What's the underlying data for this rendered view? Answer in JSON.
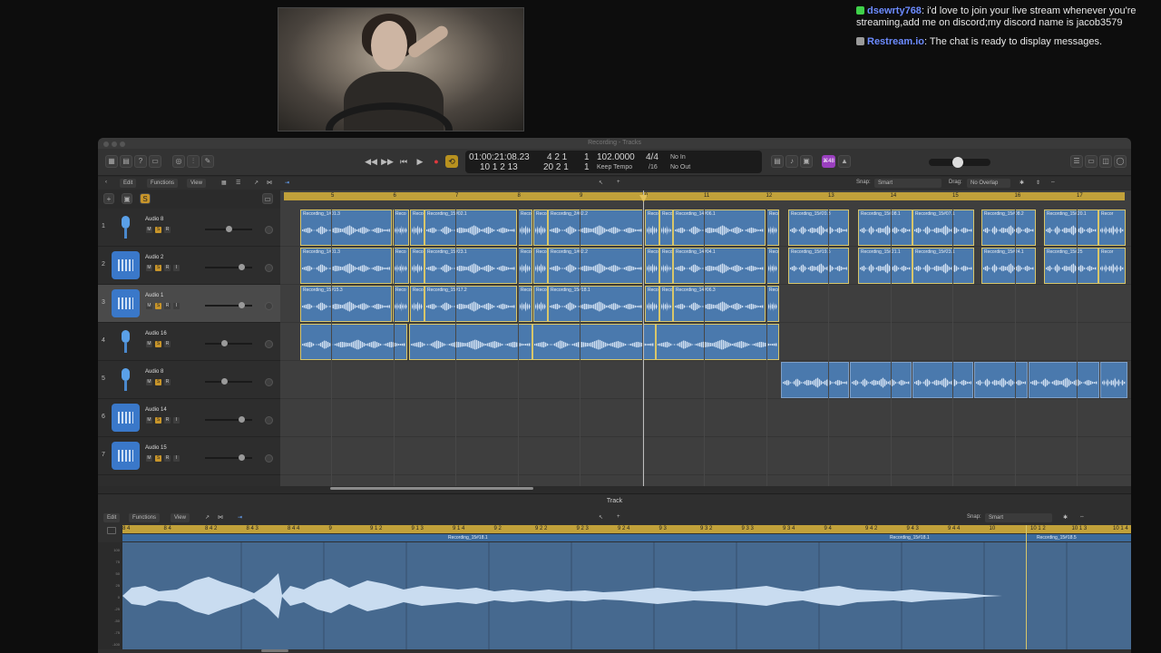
{
  "chat": {
    "messages": [
      {
        "user": "dsewrty768",
        "text": "i'd love to join your live stream whenever you're streaming,add me on discord;my discord name is jacob3579",
        "icon_color": "#3fd14a"
      },
      {
        "user": "Restream.io",
        "text": "The chat is ready to display messages.",
        "icon_color": "#9a9a9a"
      }
    ]
  },
  "window": {
    "title": "Recording - Tracks"
  },
  "lcd": {
    "time": "01:00:21:08.23",
    "time_sub": "10  1  2   13",
    "bars": "4  2  1",
    "bars_beat": "1",
    "bars_sub": "20  2  1",
    "bars_sub_beat": "1",
    "tempo": "102.0000",
    "tempo_label": "Keep Tempo",
    "signature": "4/4",
    "division": "/16",
    "in_label": "No In",
    "out_label": "No Out"
  },
  "toolbar": {
    "edit": "Edit",
    "functions": "Functions",
    "view": "View",
    "snap_label": "Snap:",
    "snap_value": "Smart",
    "drag_label": "Drag:",
    "drag_value": "No Overlap",
    "purple_badge": "⌘48"
  },
  "ruler": [
    "5",
    "6",
    "7",
    "8",
    "9",
    "10",
    "11",
    "12",
    "13",
    "14",
    "15",
    "16",
    "17"
  ],
  "tracks": [
    {
      "num": "1",
      "name": "Audio 8",
      "icon": "microphone-icon",
      "selected": false,
      "volume": 0.5
    },
    {
      "num": "2",
      "name": "Audio 2",
      "icon": "waveform-icon",
      "selected": false,
      "volume": 0.83
    },
    {
      "num": "3",
      "name": "Audio 1",
      "icon": "waveform-icon",
      "selected": true,
      "volume": 0.83
    },
    {
      "num": "4",
      "name": "Audio 16",
      "icon": "microphone-icon",
      "selected": false,
      "volume": 0.4
    },
    {
      "num": "5",
      "name": "Audio 8",
      "icon": "microphone-icon",
      "selected": false,
      "volume": 0.4
    },
    {
      "num": "6",
      "name": "Audio 14",
      "icon": "waveform-icon",
      "selected": false,
      "volume": 0.83
    },
    {
      "num": "7",
      "name": "Audio 15",
      "icon": "waveform-icon",
      "selected": false,
      "volume": 0.83
    }
  ],
  "regions": {
    "row1": [
      "Recording_1#01.3",
      "Reco",
      "Reco",
      "Recording_15#02.1",
      "Reco",
      "Reco",
      "Recording_2#02.2",
      "Reco",
      "Reco",
      "Recording_14#06.1",
      "Reco",
      "Recording_15#20.3",
      "Recording_15#08.1",
      "Recording_15#07.1",
      "Recording_15#08.2",
      "Recording_15#20.1",
      "Recor"
    ],
    "row2": [
      "Recording_1#01.3",
      "Reco",
      "Reco",
      "Recording_15#23.1",
      "Reco",
      "Reco",
      "Recording_1#02.2",
      "Reco",
      "Reco",
      "Recording_14#04.1",
      "Reco",
      "Recording_15#19.5",
      "Recording_15#21.1",
      "Recording_15#23.1",
      "Recording_15#24.1",
      "Recording_15#25",
      "Recor"
    ],
    "row3": [
      "Recording_15#15.3",
      "Reco",
      "Reco",
      "Recording_15#17.2",
      "Reco",
      "Reco",
      "Recording_15#18.1",
      "Reco",
      "Reco",
      "Recording_14#06.3",
      "Reco"
    ]
  },
  "editor": {
    "title": "Track",
    "snap_value": "Smart",
    "ruler": [
      "8 4",
      "8 4",
      "8 4 2",
      "8 4 3",
      "8 4 4",
      "9",
      "9 1 2",
      "9 1 3",
      "9 1 4",
      "9 2",
      "9 2 2",
      "9 2 3",
      "9 2 4",
      "9 3",
      "9 3 2",
      "9 3 3",
      "9 3 4",
      "9 4",
      "9 4 2",
      "9 4 3",
      "9 4 4",
      "10",
      "10 1 2",
      "10 1 3",
      "10 1 4"
    ],
    "region_labels": [
      "Recording_15#18.1",
      "Recording_15#18.1",
      "Recording_15#18.5"
    ],
    "scale": [
      "100",
      "75",
      "50",
      "25",
      "0",
      "-25",
      "-50",
      "-75",
      "-100"
    ]
  }
}
